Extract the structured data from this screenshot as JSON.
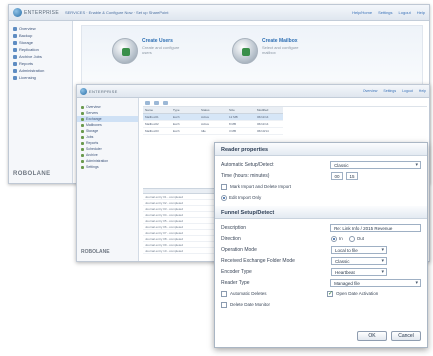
{
  "window1": {
    "logo_text": "ENTERPRISE",
    "breadcrumb": "SERVICES · Enable & Configure Now · Set up SharePoint",
    "links": [
      "Help/Home",
      "Settings",
      "Logout",
      "Help"
    ],
    "sidebar": [
      "Overview",
      "Backup",
      "Storage",
      "Replication",
      "Archive Jobs",
      "Reports",
      "Administration",
      "Licensing"
    ],
    "brand": "ROBOLANE",
    "features": [
      {
        "title": "Create Users",
        "desc": "Create and configure users"
      },
      {
        "title": "Create Mailbox",
        "desc": "Select and configure mailbox"
      }
    ]
  },
  "window2": {
    "logo_text": "ENTERPRISE",
    "top_links": [
      "Overview",
      "Settings",
      "Logout",
      "Help"
    ],
    "tree": [
      "Overview",
      "Servers",
      "Exchange",
      "Mailboxes",
      "Storage",
      "Jobs",
      "Reports",
      "Scheduler",
      "Archive",
      "Administration",
      "Settings"
    ],
    "brand": "ROBOLANE",
    "grid_headers": [
      "Name",
      "Type",
      "Status",
      "Size",
      "Modified"
    ],
    "grid_rows": [
      [
        "Mailbox01",
        "Exch",
        "Active",
        "12 MB",
        "06/11/14"
      ],
      [
        "Mailbox02",
        "Exch",
        "Active",
        "8 MB",
        "06/11/14"
      ],
      [
        "Mailbox03",
        "Exch",
        "Idle",
        "3 MB",
        "06/10/14"
      ]
    ],
    "lower_rows": [
      "Journal entry 01 - completed",
      "Journal entry 02 - completed",
      "Journal entry 03 - completed",
      "Journal entry 04 - completed",
      "Journal entry 05 - completed",
      "Journal entry 06 - completed",
      "Journal entry 07 - completed",
      "Journal entry 08 - completed",
      "Journal entry 09 - completed",
      "Journal entry 10 - completed"
    ]
  },
  "dialog": {
    "reader_title": "Reader properties",
    "auto_label": "Automatic Setup/Detect",
    "auto_value": "Classic",
    "time_label": "Time (hours: minutes)",
    "time_hours": "00",
    "time_minutes": "15",
    "mark_label": "Mark Import and Delete Import",
    "edit_label": "Edit Import Only",
    "funnel_title": "Funnel Setup/Detect",
    "description_label": "Description",
    "description_value": "Re: Link Info / 2015 Revenue",
    "direction_label": "Direction",
    "direction_in": "In",
    "direction_out": "Out",
    "operation_label": "Operation Mode",
    "operation_value": "Local to file",
    "exchange_label": "Received Exchange Folder Mode",
    "exchange_value": "Classic",
    "encoder_label": "Encoder Type",
    "encoder_value": "Heartbeat",
    "reader_type_label": "Reader Type",
    "reader_type_value": "Managed file",
    "auto_delete_label": "Automatic Deletes",
    "open_active_label": "Open Date Activation",
    "delete_label": "Delete Date Monitor",
    "ok": "OK",
    "cancel": "Cancel"
  }
}
